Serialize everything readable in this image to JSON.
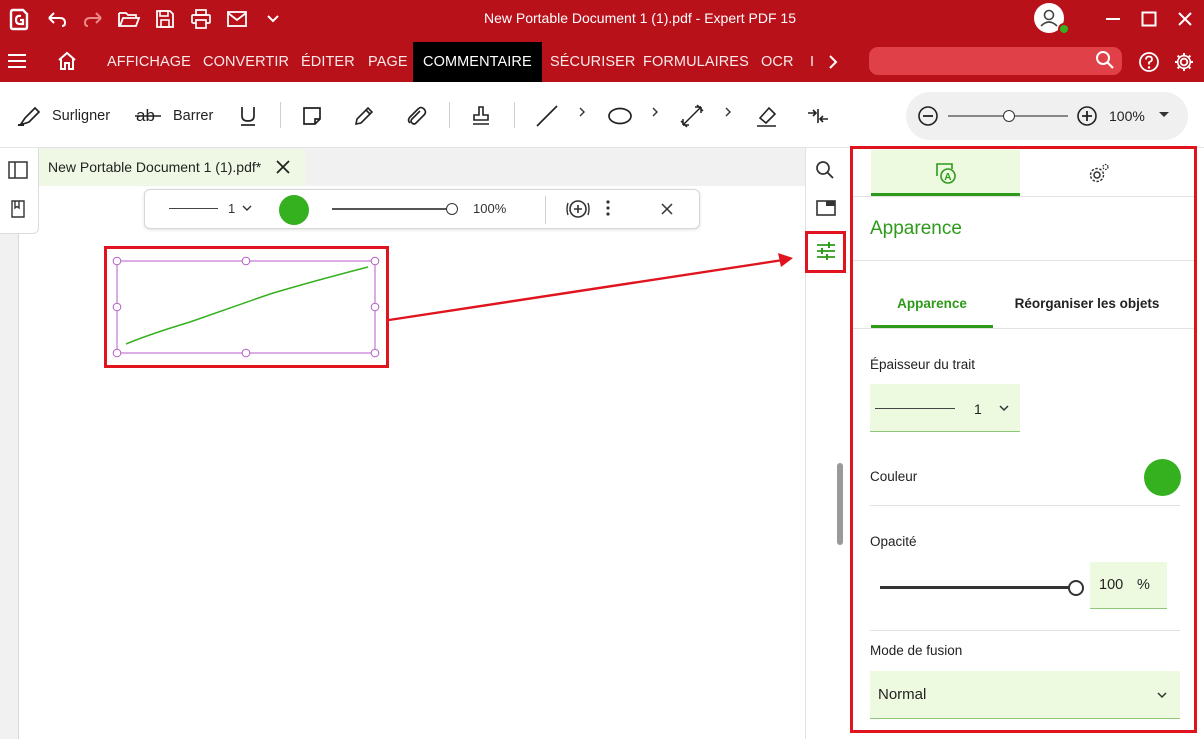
{
  "window": {
    "title": "New Portable Document 1 (1).pdf  -  Expert PDF 15"
  },
  "menu": {
    "items": [
      "AFFICHAGE",
      "CONVERTIR",
      "ÉDITER",
      "PAGE",
      "COMMENTAIRE",
      "SÉCURISER",
      "FORMULAIRES",
      "OCR",
      "I"
    ],
    "active": "COMMENTAIRE"
  },
  "toolbar": {
    "highlight_label": "Surligner",
    "strike_label": "Barrer",
    "zoom_value": "100%"
  },
  "document": {
    "tab_title": "New Portable Document 1 (1).pdf*"
  },
  "floatbar": {
    "width_value": "1",
    "opacity_value": "100%",
    "opacity_level": 1.0
  },
  "panel": {
    "title": "Apparence",
    "tabs": [
      "Apparence",
      "Réorganiser les objets"
    ],
    "stroke_label": "Épaisseur du trait",
    "stroke_value": "1",
    "color_label": "Couleur",
    "color_value": "#35b01f",
    "opacity_label": "Opacité",
    "opacity_value": "100",
    "opacity_unit": "%",
    "opacity_level": 1.0,
    "blend_label": "Mode de fusion",
    "blend_value": "Normal"
  },
  "colors": {
    "brand": "#b8111a",
    "accent": "#2e9a1a",
    "highlight_frame": "#e0141e"
  }
}
